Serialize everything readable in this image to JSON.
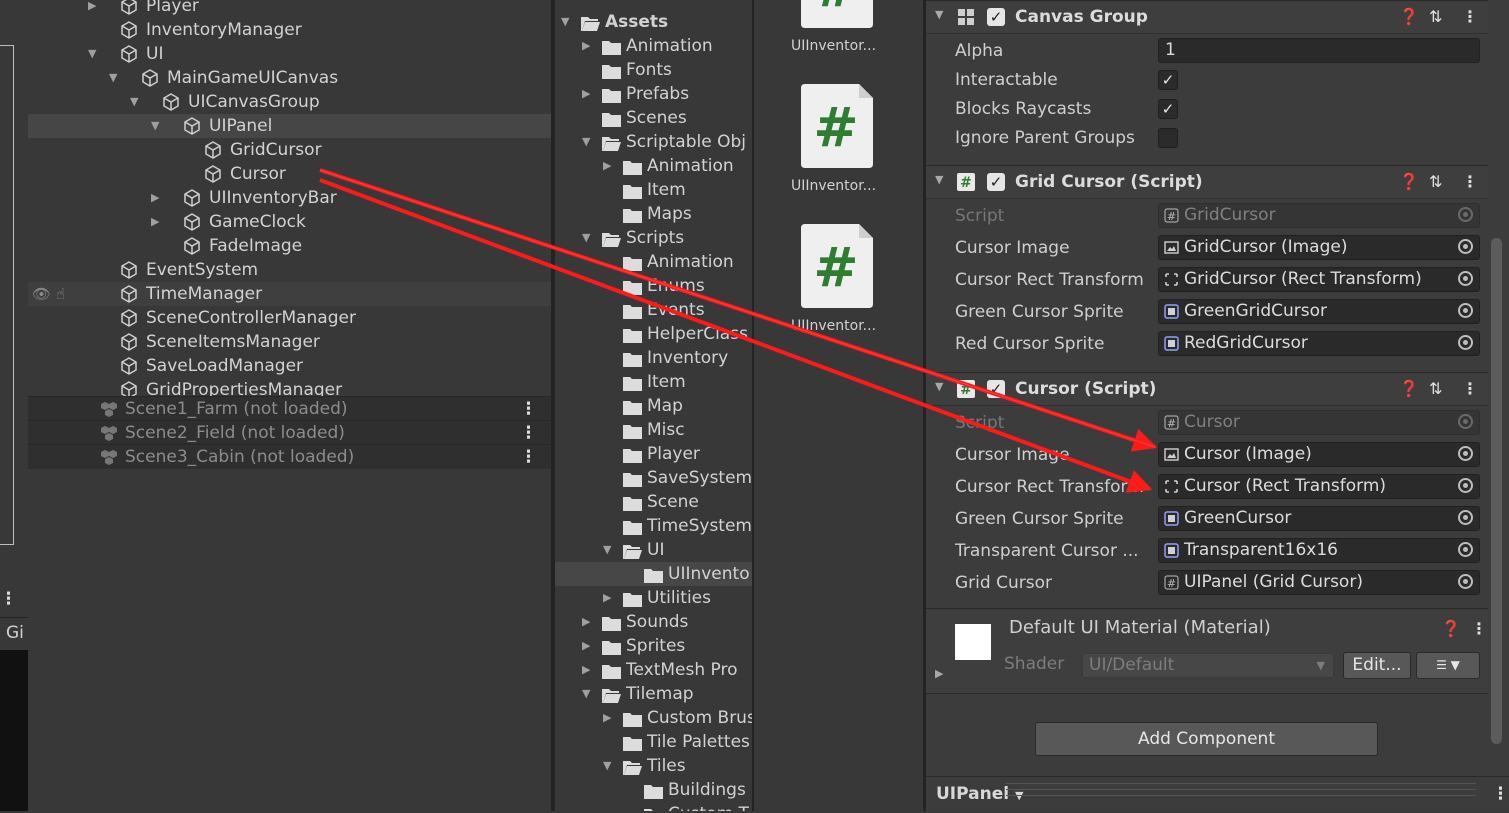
{
  "hierarchy": {
    "items": [
      {
        "label": "Player",
        "depth": 0
      },
      {
        "label": "InventoryManager",
        "depth": 0
      },
      {
        "label": "UI",
        "depth": 0,
        "expanded": true
      },
      {
        "label": "MainGameUICanvas",
        "depth": 1,
        "expanded": true
      },
      {
        "label": "UICanvasGroup",
        "depth": 2,
        "expanded": true
      },
      {
        "label": "UIPanel",
        "depth": 3,
        "expanded": true,
        "selected": true
      },
      {
        "label": "GridCursor",
        "depth": 4
      },
      {
        "label": "Cursor",
        "depth": 4
      },
      {
        "label": "UIInventoryBar",
        "depth": 3,
        "collapsed": true
      },
      {
        "label": "GameClock",
        "depth": 3,
        "collapsed": true
      },
      {
        "label": "FadeImage",
        "depth": 3
      },
      {
        "label": "EventSystem",
        "depth": 0
      },
      {
        "label": "TimeManager",
        "depth": 0
      },
      {
        "label": "SceneControllerManager",
        "depth": 0
      },
      {
        "label": "SceneItemsManager",
        "depth": 0
      },
      {
        "label": "SaveLoadManager",
        "depth": 0
      },
      {
        "label": "GridPropertiesManager",
        "depth": 0
      }
    ],
    "scenes": [
      "Scene1_Farm (not loaded)",
      "Scene2_Field (not loaded)",
      "Scene3_Cabin (not loaded)"
    ]
  },
  "left_strip": {
    "tab_label": "Gi"
  },
  "project_tree": {
    "items": [
      {
        "label": "Assets",
        "depth": 0,
        "open": true,
        "bold": true
      },
      {
        "label": "Animation",
        "depth": 1,
        "arrow": "right"
      },
      {
        "label": "Fonts",
        "depth": 1
      },
      {
        "label": "Prefabs",
        "depth": 1,
        "arrow": "right"
      },
      {
        "label": "Scenes",
        "depth": 1
      },
      {
        "label": "Scriptable Obj",
        "depth": 1,
        "open": true
      },
      {
        "label": "Animation",
        "depth": 2,
        "arrow": "right"
      },
      {
        "label": "Item",
        "depth": 2
      },
      {
        "label": "Maps",
        "depth": 2
      },
      {
        "label": "Scripts",
        "depth": 1,
        "open": true
      },
      {
        "label": "Animation",
        "depth": 2
      },
      {
        "label": "Enums",
        "depth": 2
      },
      {
        "label": "Events",
        "depth": 2
      },
      {
        "label": "HelperClass",
        "depth": 2
      },
      {
        "label": "Inventory",
        "depth": 2
      },
      {
        "label": "Item",
        "depth": 2
      },
      {
        "label": "Map",
        "depth": 2
      },
      {
        "label": "Misc",
        "depth": 2
      },
      {
        "label": "Player",
        "depth": 2
      },
      {
        "label": "SaveSystem",
        "depth": 2
      },
      {
        "label": "Scene",
        "depth": 2
      },
      {
        "label": "TimeSystem",
        "depth": 2
      },
      {
        "label": "UI",
        "depth": 2,
        "open": true
      },
      {
        "label": "UIInvento",
        "depth": 3,
        "selected": true
      },
      {
        "label": "Utilities",
        "depth": 2,
        "arrow": "right"
      },
      {
        "label": "Sounds",
        "depth": 1,
        "arrow": "right"
      },
      {
        "label": "Sprites",
        "depth": 1,
        "arrow": "right"
      },
      {
        "label": "TextMesh Pro",
        "depth": 1,
        "arrow": "right"
      },
      {
        "label": "Tilemap",
        "depth": 1,
        "open": true
      },
      {
        "label": "Custom Brus",
        "depth": 2,
        "arrow": "right"
      },
      {
        "label": "Tile Palettes",
        "depth": 2
      },
      {
        "label": "Tiles",
        "depth": 2,
        "open": true
      },
      {
        "label": "Buildings",
        "depth": 3
      },
      {
        "label": "Custom T",
        "depth": 3
      }
    ]
  },
  "asset_grid": {
    "items": [
      {
        "label": "UIInventor..."
      },
      {
        "label": "UIInventor..."
      },
      {
        "label": "UIInventor..."
      }
    ]
  },
  "inspector": {
    "canvas_group": {
      "title": "Canvas Group",
      "props": {
        "alpha_label": "Alpha",
        "alpha_value": "1",
        "interactable_label": "Interactable",
        "blocks_label": "Blocks Raycasts",
        "ignore_label": "Ignore Parent Groups"
      }
    },
    "grid_cursor": {
      "title": "Grid Cursor (Script)",
      "rows": [
        {
          "label": "Script",
          "value": "GridCursor",
          "disabled": true,
          "icon": "script"
        },
        {
          "label": "Cursor Image",
          "value": "GridCursor (Image)",
          "icon": "image"
        },
        {
          "label": "Cursor Rect Transform",
          "value": "GridCursor (Rect Transform)",
          "icon": "rect"
        },
        {
          "label": "Green Cursor Sprite",
          "value": "GreenGridCursor",
          "icon": "sprite"
        },
        {
          "label": "Red Cursor Sprite",
          "value": "RedGridCursor",
          "icon": "sprite"
        }
      ]
    },
    "cursor": {
      "title": "Cursor (Script)",
      "rows": [
        {
          "label": "Script",
          "value": "Cursor",
          "disabled": true,
          "icon": "script"
        },
        {
          "label": "Cursor Image",
          "value": "Cursor (Image)",
          "icon": "image"
        },
        {
          "label": "Cursor Rect Transform",
          "value": "Cursor (Rect Transform)",
          "icon": "rect"
        },
        {
          "label": "Green Cursor Sprite",
          "value": "GreenCursor",
          "icon": "sprite"
        },
        {
          "label": "Transparent Cursor ...",
          "value": "Transparent16x16",
          "icon": "sprite"
        },
        {
          "label": "Grid Cursor",
          "value": "UIPanel (Grid Cursor)",
          "icon": "script"
        }
      ]
    },
    "material": {
      "title": "Default UI Material (Material)",
      "shader_label": "Shader",
      "shader_value": "UI/Default",
      "edit_label": "Edit..."
    },
    "add_component": "Add Component",
    "bottom_label": "UIPanel"
  },
  "colors": {
    "accent_arrow": "#ff1a1a",
    "selection": "#464646",
    "panel": "#383838"
  }
}
